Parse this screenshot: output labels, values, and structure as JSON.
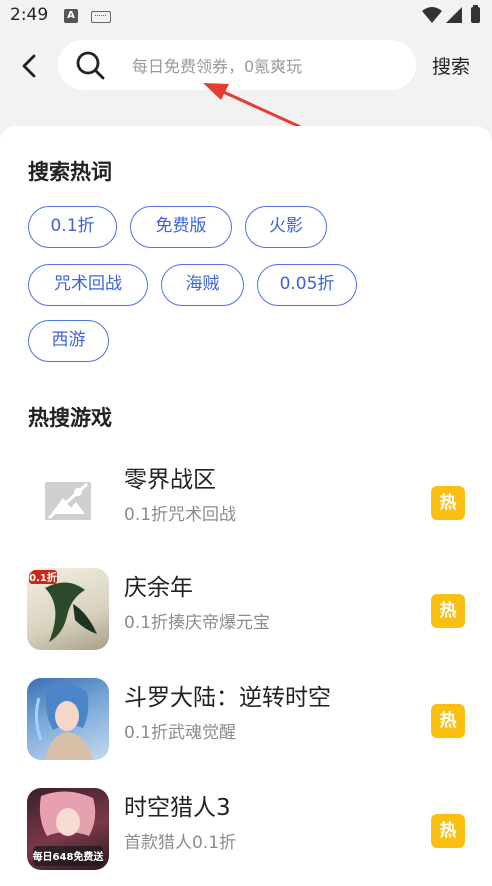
{
  "status_bar": {
    "time": "2:49",
    "input_badge": "A"
  },
  "header": {
    "search_placeholder": "每日免费领券，0氪爽玩",
    "search_button": "搜索"
  },
  "hot_words": {
    "title": "搜索热词",
    "tags": [
      "0.1折",
      "免费版",
      "火影",
      "咒术回战",
      "海贼",
      "0.05折",
      "西游"
    ]
  },
  "hot_games": {
    "title": "热搜游戏",
    "badge": "热",
    "items": [
      {
        "name": "零界战区",
        "desc": "0.1折咒术回战"
      },
      {
        "name": "庆余年",
        "desc": "0.1折揍庆帝爆元宝",
        "icon_text": "0.1折"
      },
      {
        "name": "斗罗大陆：逆转时空",
        "desc": "0.1折武魂觉醒"
      },
      {
        "name": "时空猎人3",
        "desc": "首款猎人0.1折",
        "icon_text": "每日648免费送"
      }
    ]
  },
  "colors": {
    "accent": "#3d63d8",
    "hot": "#fbbf12",
    "annotation": "#e83a30"
  }
}
